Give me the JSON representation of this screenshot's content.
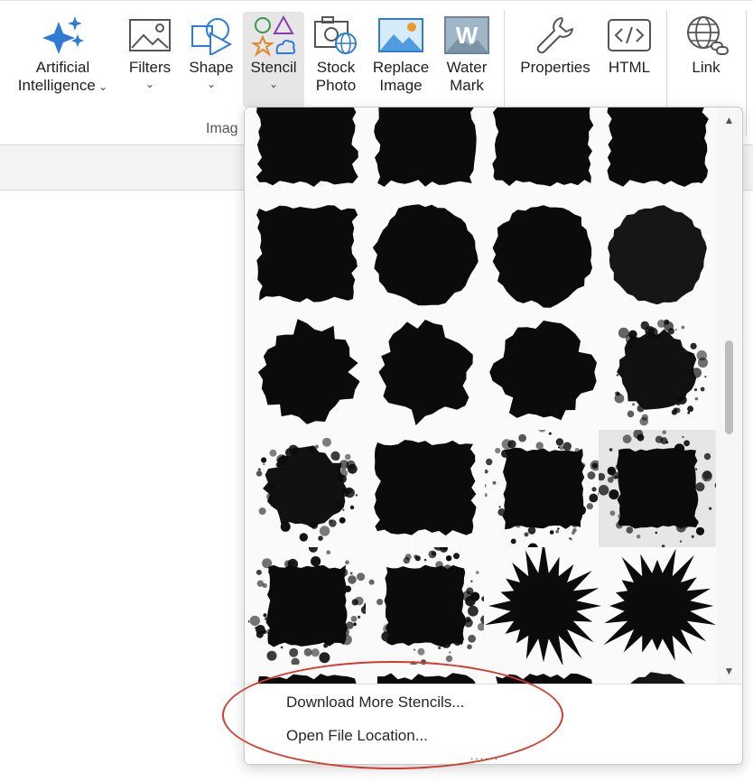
{
  "ribbon": {
    "buttons": [
      {
        "id": "ai",
        "line1": "Artificial",
        "line2": "Intelligence",
        "icon": "sparkles-icon"
      },
      {
        "id": "filters",
        "line1": "Filters",
        "icon": "image-icon"
      },
      {
        "id": "shape",
        "line1": "Shape",
        "icon": "shape-icon"
      },
      {
        "id": "stencil",
        "line1": "Stencil",
        "icon": "stencil-icon"
      },
      {
        "id": "stock",
        "line1": "Stock",
        "line2": "Photo",
        "icon": "stock-photo-icon"
      },
      {
        "id": "replace",
        "line1": "Replace",
        "line2": "Image",
        "icon": "replace-image-icon"
      },
      {
        "id": "water",
        "line1": "Water",
        "line2": "Mark",
        "icon": "watermark-icon"
      },
      {
        "id": "properties",
        "line1": "Properties",
        "icon": "wrench-icon"
      },
      {
        "id": "html",
        "line1": "HTML",
        "icon": "code-icon"
      },
      {
        "id": "link",
        "line1": "Link",
        "icon": "globe-link-icon"
      }
    ],
    "group_label": "Imag"
  },
  "dropdown": {
    "menu": {
      "download": "Download More Stencils...",
      "open_location": "Open File Location..."
    },
    "grip": "......",
    "selected_stencil_row": 4,
    "selected_stencil_col": 4
  },
  "colors": {
    "accent_blue": "#2f7bd5",
    "annotation_red": "#d43a2f",
    "stencil_fill": "#0b0b0b"
  }
}
